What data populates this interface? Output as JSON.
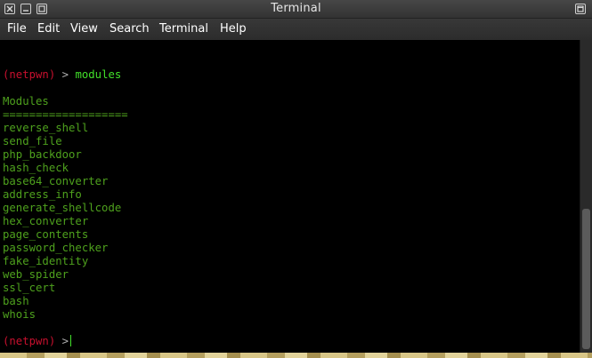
{
  "window": {
    "title": "Terminal"
  },
  "menubar": {
    "items": [
      "File",
      "Edit",
      "View",
      "Search",
      "Terminal",
      "Help"
    ]
  },
  "terminal": {
    "prompt_user": "(netpwn)",
    "prompt_symbol": ">",
    "command": "modules",
    "heading": "Modules",
    "separator": "===================",
    "modules": [
      "reverse_shell",
      "send_file",
      "php_backdoor",
      "hash_check",
      "base64_converter",
      "address_info",
      "generate_shellcode",
      "hex_converter",
      "page_contents",
      "password_checker",
      "fake_identity",
      "web_spider",
      "ssl_cert",
      "bash",
      "whois"
    ]
  },
  "colors": {
    "prompt": "#c8102e",
    "command": "#42e02a",
    "output": "#4ea11d",
    "background": "#000000"
  },
  "icons": [
    "close-icon",
    "minimize-icon",
    "maximize-icon",
    "restore-icon"
  ]
}
